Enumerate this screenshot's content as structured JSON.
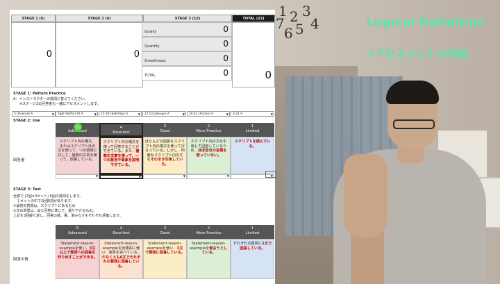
{
  "overlay": {
    "title": "Logical Refleltion",
    "subtitle": "③アセスメントの内容"
  },
  "clock": {
    "digits": [
      "1",
      "2",
      "3",
      "4",
      "5",
      "6",
      "7"
    ]
  },
  "sheet": {
    "headers": {
      "stage1": "STAGE 1 (6)",
      "stage2": "STAGE 2 (4)",
      "stage3": "STAGE 3 (12)",
      "total": "TOTAL (22)"
    },
    "scores": {
      "stage1": "0",
      "stage2": "0",
      "total": "0",
      "rows": [
        {
          "label": "Quality",
          "value": "0"
        },
        {
          "label": "Quantity",
          "value": "0"
        },
        {
          "label": "Smoothness",
          "value": "0"
        },
        {
          "label": "TOTAL",
          "value": "0"
        }
      ]
    },
    "stage1": {
      "title": "STAGE 1: Pattern Practice",
      "line1": "A：インストラクターの質問に答えてください。",
      "line2": "※ステージ2の回答者も一緒にアセスメントします。",
      "dropdowns": [
        "3 (Overall) A",
        "5&8 (Reflect P) A",
        "15-16 (Self-Imp) A",
        "17 (Challenge) A",
        "20-21 (Action) A",
        "3-21 A"
      ]
    },
    "stage2": {
      "title": "STAGE 2: Use",
      "row_label": "回答者",
      "levels": [
        {
          "num": "5",
          "name": "Advanced"
        },
        {
          "num": "4",
          "name": "Excellent"
        },
        {
          "num": "3",
          "name": "Good"
        },
        {
          "num": "2",
          "name": "More Practice"
        },
        {
          "num": "1",
          "name": "Limited"
        }
      ],
      "cells": [
        {
          "pre": "スクリプト内の構文、またはスクリプト外の文を使って、",
          "hl": "",
          "post": "つの質問に対して、複数の文章を使って、回答している。"
        },
        {
          "pre": "スクリプト内の構文を使って回答することができている。また、",
          "hl": "複数の文章を使って、一つの意見や事象を説明できている。",
          "post": ""
        },
        {
          "pre": "ほとんどの回答をスクリプト内の構文を使って行なっている。しかし、何度かスクリプト内の文を",
          "hl": "そのまま引用している。",
          "post": ""
        },
        {
          "pre": "スクリプト内の文を引用して回答しているため、",
          "hl": "ほぼ自分の言葉を使っていない。",
          "post": ""
        },
        {
          "pre": "",
          "hl": "スクリプトを読んでいる。",
          "post": ""
        }
      ]
    },
    "stage3": {
      "title": "STAGE 3: Test",
      "lines": [
        "全部で (2回×3セット) 6回の質問をします。",
        "１セットの中で2回質問があります。",
        "①最初の質問は、スクリプトにあるもの",
        "②次の質問は、出た回答に準じて、掘り下げるもの。",
        "上記を3回繰り返し、回答の質、量、滑みなさをそれぞれ評価します。"
      ],
      "row_label": "回答の質",
      "levels": [
        {
          "num": "5",
          "name": "Advanced"
        },
        {
          "num": "4",
          "name": "Excellent"
        },
        {
          "num": "3",
          "name": "Good"
        },
        {
          "num": "2",
          "name": "More Practice"
        },
        {
          "num": "1",
          "name": "Limited"
        }
      ],
      "cells": [
        {
          "pre": "Statement-reason-exampleを使い、",
          "hl": "3文以上で質問への回答を作り出すことができる。",
          "post": ""
        },
        {
          "pre": "Statement-reason-exampleを効果的に使い、意見を述べている。",
          "hl": "少なくとも6文でそれぞれの質問に回答している。",
          "post": ""
        },
        {
          "pre": "Statement-reason-exampleを使い、",
          "hl": "3文で質問に回答している。",
          "post": ""
        },
        {
          "pre": "Statement-reason-exampleを",
          "hl": "使おうとしている。",
          "post": ""
        },
        {
          "pre": "それぞれの質問に",
          "hl": "1文で回答している。",
          "post": ""
        }
      ]
    }
  },
  "colors": {
    "accent": "#62e2b0",
    "advanced": "#f6d3d3",
    "excellent": "#fbe3cf",
    "good": "#fbeec6",
    "more_practice": "#dcefd4",
    "limited": "#d6e3f5",
    "header_dark": "#555555",
    "highlight_text": "#b00000"
  }
}
